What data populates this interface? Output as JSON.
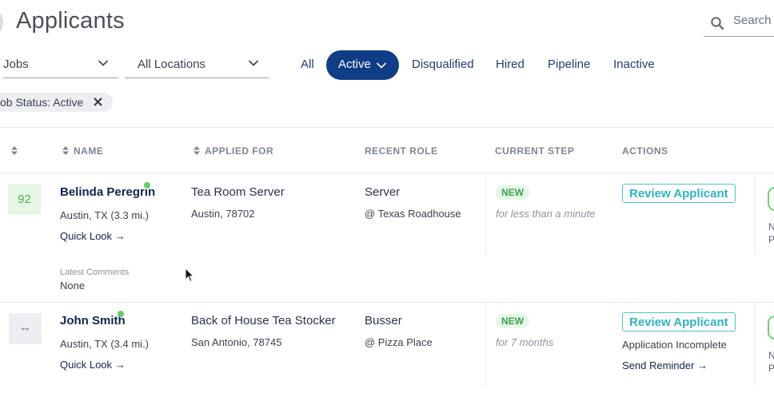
{
  "header": {
    "title": "Applicants",
    "search_placeholder": "Search"
  },
  "filters": {
    "jobs_select": "Jobs",
    "locations_select": "All Locations",
    "tabs": [
      {
        "label": "All"
      },
      {
        "label": "Active"
      },
      {
        "label": "Disqualified"
      },
      {
        "label": "Hired"
      },
      {
        "label": "Pipeline"
      },
      {
        "label": "Inactive"
      }
    ],
    "active_tab": "Active",
    "chip": "ob Status: Active"
  },
  "table": {
    "columns": {
      "name": "NAME",
      "applied_for": "APPLIED FOR",
      "recent_role": "RECENT ROLE",
      "current_step": "CURRENT STEP",
      "actions": "ACTIONS"
    },
    "rows": [
      {
        "score": "92",
        "name": "Belinda Peregrin",
        "location": "Austin, TX (3.3 mi.)",
        "quick_look": "Quick Look →",
        "applied_for": "Tea Room Server",
        "applied_location": "Austin, 78702",
        "recent_role": "Server",
        "recent_employer": "@ Texas Roadhouse",
        "step": "NEW",
        "step_duration": "for less than a minute",
        "action": "Review Applicant",
        "comments_label": "Latest Comments",
        "comments_value": "None",
        "edge_label": "N",
        "edge_value": "P"
      },
      {
        "score": "--",
        "name": "John Smith",
        "location": "Austin, TX (3.4 mi.)",
        "quick_look": "Quick Look →",
        "applied_for": "Back of House Tea Stocker",
        "applied_location": "San Antonio, 78745",
        "recent_role": "Busser",
        "recent_employer": "@ Pizza Place",
        "step": "NEW",
        "step_duration": "for 7 months",
        "action": "Review Applicant",
        "status_note": "Application Incomplete",
        "secondary_action": "Send Reminder →",
        "edge_label": "N",
        "edge_value": "P"
      }
    ]
  },
  "colors": {
    "primary": "#0f3d86",
    "accent_teal": "#2fb3c0",
    "success_green": "#4caf50",
    "online_dot": "#5ccf6a"
  }
}
